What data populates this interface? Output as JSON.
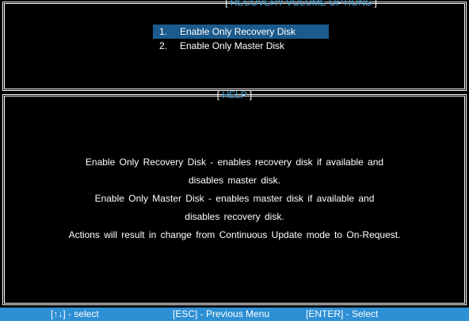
{
  "top_panel": {
    "title": "RECOVERY VOLUME OPTIONS",
    "items": [
      {
        "num": "1.",
        "label": "Enable Only Recovery Disk",
        "selected": true
      },
      {
        "num": "2.",
        "label": "Enable Only Master Disk",
        "selected": false
      }
    ]
  },
  "help_panel": {
    "title": "HELP",
    "lines": [
      "Enable Only Recovery Disk - enables recovery disk if available and",
      "disables master disk.",
      "Enable Only Master Disk - enables master disk if available and",
      "disables recovery disk.",
      "Actions will result in change from Continuous Update mode to On-Request."
    ]
  },
  "footer": {
    "select": "[↑↓] - select",
    "previous": "[ESC] - Previous Menu",
    "enter": "[ENTER] - Select"
  },
  "colors": {
    "accent": "#3aa6df",
    "selection": "#1b5a8c",
    "footer_bg": "#2d8fd4"
  }
}
